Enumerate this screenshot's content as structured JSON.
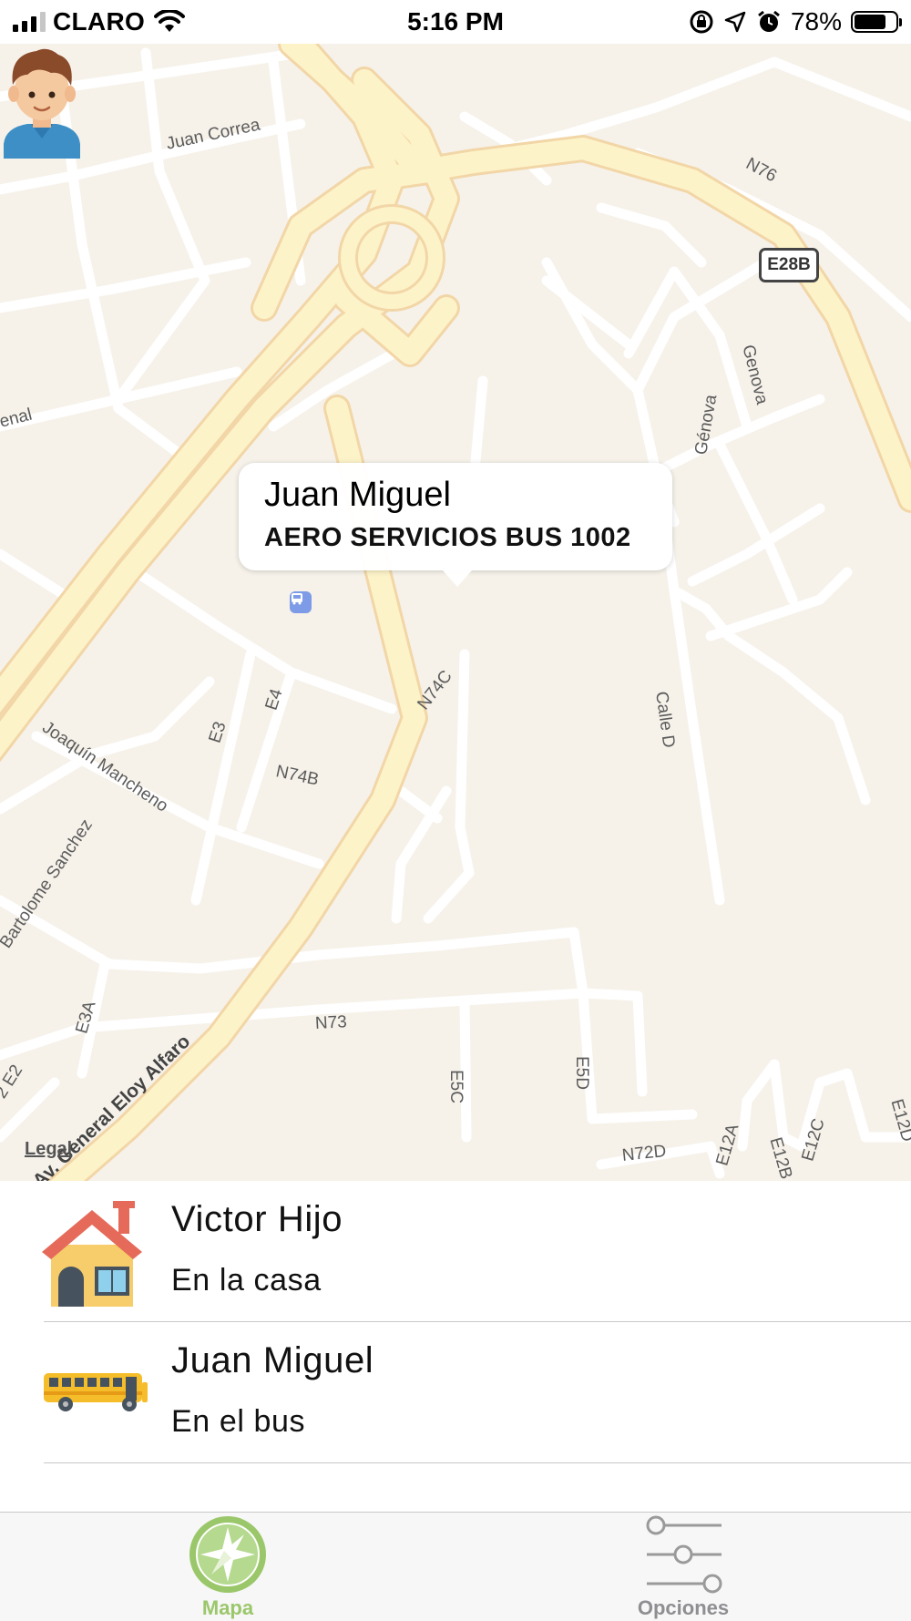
{
  "status_bar": {
    "carrier": "CLARO",
    "time": "5:16 PM",
    "battery_percent": "78%",
    "battery_level": 0.78,
    "icons": [
      "signal-bars-icon",
      "wifi-icon",
      "orientation-lock-icon",
      "location-arrow-icon",
      "alarm-icon",
      "battery-icon"
    ]
  },
  "map": {
    "labels": {
      "juan_correa": "Juan Correa",
      "n76": "N76",
      "e28b": "E28B",
      "genova_right": "Genova",
      "genova_left": "Génova",
      "enal": "enal",
      "calle_d": "Calle D",
      "n74c": "N74C",
      "joaquin": "Joaquín Mancheno",
      "e3": "E3",
      "e4": "E4",
      "n74b": "N74B",
      "bartolome": "Bartolome Sanchez",
      "e3a": "E3A",
      "n73": "N73",
      "e5c": "E5C",
      "e5d": "E5D",
      "e2": "2 E2",
      "eloy": "Av. General Eloy Alfaro",
      "n72d": "N72D",
      "e12a": "E12A",
      "e12b": "E12B",
      "e12c": "E12C",
      "e12d": "E12D",
      "calle_fragment": "lle"
    },
    "legal": "Legal",
    "callout": {
      "title": "Juan Miguel",
      "subtitle": "AERO SERVICIOS BUS 1002"
    },
    "pin_icon": "boy-avatar-icon"
  },
  "list": {
    "items": [
      {
        "name": "Victor  Hijo",
        "status": "En la casa",
        "icon": "house-icon"
      },
      {
        "name": "Juan Miguel",
        "status": "En el bus",
        "icon": "school-bus-icon"
      }
    ]
  },
  "tab_bar": {
    "tabs": [
      {
        "label": "Mapa",
        "icon": "compass-icon",
        "active": true
      },
      {
        "label": "Opciones",
        "icon": "sliders-icon",
        "active": false
      }
    ],
    "active_color": "#9bc76b",
    "inactive_color": "#8e8e93"
  }
}
